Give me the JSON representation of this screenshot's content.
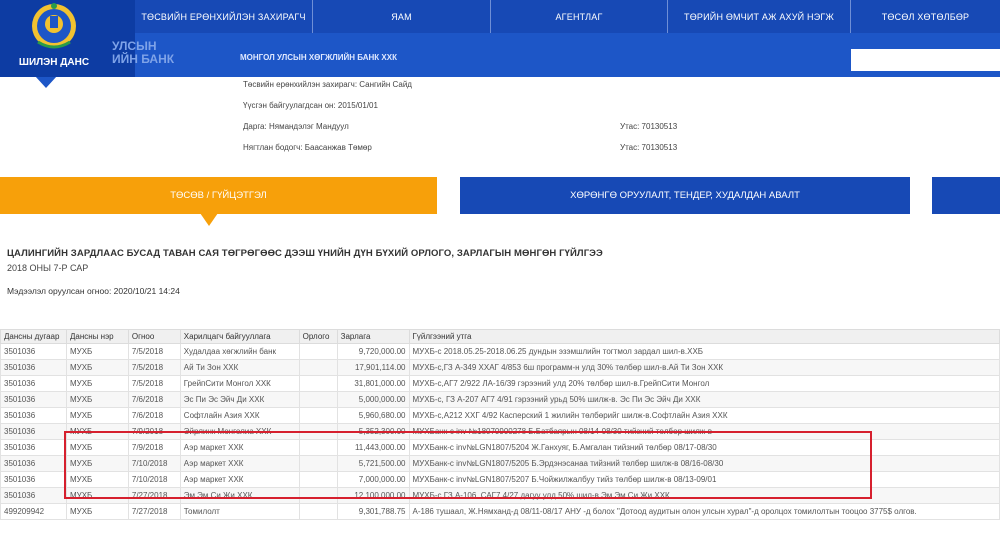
{
  "header": {
    "logo_text": "ШИЛЭН ДАНС",
    "nav": [
      "ТӨСВИЙН ЕРӨНХИЙЛЭН ЗАХИРАГЧ",
      "ЯАМ",
      "АГЕНТЛАГ",
      "ТӨРИЙН ӨМЧИТ АЖ АХУЙ НЭГЖ",
      "ТӨСӨЛ ХӨТӨЛБӨР"
    ],
    "bank_logo_line1": "УЛСЫН",
    "bank_logo_line2": "ИЙН БАНК",
    "bank_name": "МОНГОЛ УЛСЫН ХӨГЖЛИЙН БАНК ХХК",
    "search_placeholder": ""
  },
  "info": {
    "manager": "Төсвийн ерөнхийлэн захирагч: Сангийн Сайд",
    "established": "Үүсгэн байгуулагдсан он: 2015/01/01",
    "head": "Дарга: Нямандэлэг Мандуул",
    "head_phone": "Утас: 70130513",
    "accountant": "Нягтлан бодогч: Баасанжав Төмөр",
    "accountant_phone": "Утас: 70130513"
  },
  "tabs": [
    "ТӨСӨВ / ГҮЙЦЭТГЭЛ",
    "ХӨРӨНГӨ ОРУУЛАЛТ, ТЕНДЕР, ХУДАЛДАН АВАЛТ",
    ""
  ],
  "report": {
    "title": "ЦАЛИНГИЙН ЗАРДЛААС БУСАД ТАВАН САЯ ТӨГРӨГӨӨС ДЭЭШ ҮНИЙН ДҮН БҮХИЙ ОРЛОГО, ЗАРЛАГЫН МӨНГӨН ГҮЙЛГЭЭ",
    "subtitle": "2018 ОНЫ 7-Р САР",
    "updated": "Мэдээлэл оруулсан огноо: 2020/10/21 14:24"
  },
  "table": {
    "columns": [
      "Дансны дугаар",
      "Дансны нэр",
      "Огноо",
      "Харилцагч байгууллага",
      "Орлого",
      "Зарлага",
      "Гүйлгээний утга"
    ],
    "rows": [
      [
        "3501036",
        "МУХБ",
        "7/5/2018",
        "Худалдаа хөгжлийн банк",
        "",
        "9,720,000.00",
        "МУХБ-с 2018.05.25-2018.06.25 дундын эзэмшлийн тогтмол зардал шил-в.ХХБ"
      ],
      [
        "3501036",
        "МУХБ",
        "7/5/2018",
        "Ай Ти Зон ХХК",
        "",
        "17,901,114.00",
        "МУХБ-с,ГЗ А-349 ХХАГ 4/853 6ш программ-н улд 30% төлбөр шил-в.Ай Ти Зон ХХК"
      ],
      [
        "3501036",
        "МУХБ",
        "7/5/2018",
        "ГрейпСити Монгол ХХК",
        "",
        "31,801,000.00",
        "МУХБ-с,АГ7 2/922 ЛА-16/39 гэрээний улд 20% төлбөр шил-в.ГрейпСити Монгол"
      ],
      [
        "3501036",
        "МУХБ",
        "7/6/2018",
        "Эс Пи Эс Эйч Ди ХХК",
        "",
        "5,000,000.00",
        "МУХБ-с, ГЗ А-207 АГ7 4/91 гэрээний урьд 50% шилж-в. Эс Пи Эс Эйч Ди ХХК"
      ],
      [
        "3501036",
        "МУХБ",
        "7/6/2018",
        "Софтлайн Азия ХХК",
        "",
        "5,960,680.00",
        "МУХБ-с,А212 ХХГ 4/92 Касперский 1 жилийн төлбөрийг шилж-в.Софтлайн Азия ХХК"
      ],
      [
        "3501036",
        "МУХБ",
        "7/9/2018",
        "Эйрлинк Монголиа ХХК",
        "",
        "5,352,300.00",
        "МУХБанк-с inv №18070900278 Б.Батбаярын 08/14-08/30 тийзний төлбөр шилж-в"
      ],
      [
        "3501036",
        "МУХБ",
        "7/9/2018",
        "Аэр маркет ХХК",
        "",
        "11,443,000.00",
        "МУХБанк-с inv№LGN1807/5204 Ж.Ганхуяг, Б.Амгалан тийзний төлбөр 08/17-08/30"
      ],
      [
        "3501036",
        "МУХБ",
        "7/10/2018",
        "Аэр маркет ХХК",
        "",
        "5,721,500.00",
        "МУХБанк-с inv№LGN1807/5205 Б.Эрдэнэсанаа тийзний төлбөр шилж-в 08/16-08/30"
      ],
      [
        "3501036",
        "МУХБ",
        "7/10/2018",
        "Аэр маркет ХХК",
        "",
        "7,000,000.00",
        "МУХБанк-с inv№LGN1807/5207 Б.Чойжилжалбуу тийз төлбөр шилж-в 08/13-09/01"
      ],
      [
        "3501036",
        "МУХБ",
        "7/27/2018",
        "Эм Эм Си Жи ХХК",
        "",
        "12,100,000.00",
        "МУХБ-с ГЗ А-106, САГ7 4/27 дагуу улд 50% шил-в.Эм Эм Си Жи ХХК"
      ],
      [
        "499209942",
        "МУХБ",
        "7/27/2018",
        "Томилолт",
        "",
        "9,301,788.75",
        "А-186 тушаал, Ж.Нямханд-д 08/11-08/17 АНУ -д болох \"Дотоод аудитын олон улсын хурал\"-д оролцох томилолтын тооцоо 3775$ олгов."
      ]
    ]
  },
  "colors": {
    "nav_blue": "#1749b5",
    "tab_orange": "#f7a00a",
    "highlight_red": "#d6202e"
  }
}
